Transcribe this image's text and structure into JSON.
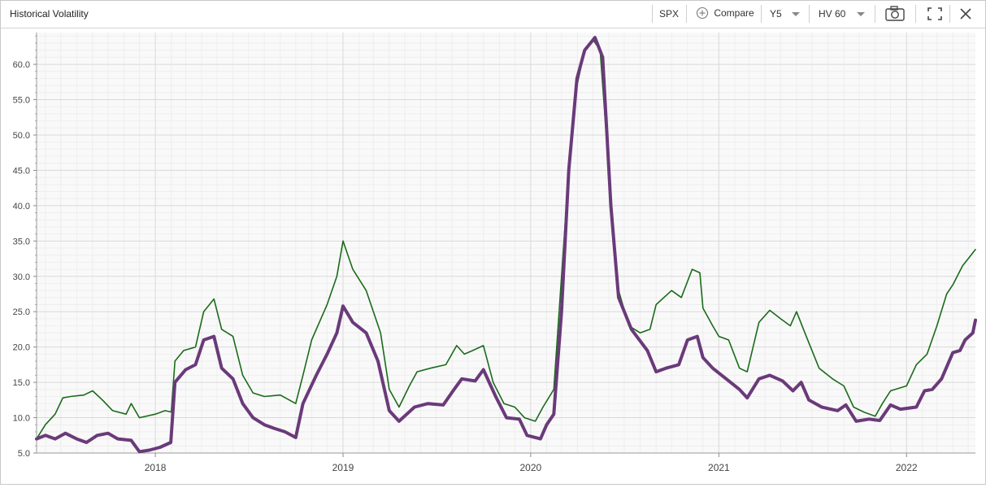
{
  "toolbar": {
    "title": "Historical Volatility",
    "symbol": "SPX",
    "compare_label": "Compare",
    "period": "Y5",
    "measure": "HV 60"
  },
  "colors": {
    "series_green": "#1a6b1a",
    "series_purple": "#6a3a7a",
    "grid_major": "#d9d9d9",
    "grid_minor": "#eeeeee",
    "plot_bg": "#f9f9f9"
  },
  "chart_data": {
    "type": "line",
    "x_axis": {
      "type": "date",
      "min": "2017-05-15",
      "max": "2022-05-15",
      "ticks": [
        "2018",
        "2019",
        "2020",
        "2021",
        "2022"
      ]
    },
    "y_axis": {
      "min": 5,
      "max": 64.5,
      "ticks": [
        "5.0",
        "10.0",
        "15.0",
        "20.0",
        "25.0",
        "30.0",
        "35.0",
        "40.0",
        "45.0",
        "50.0",
        "55.0",
        "60.0"
      ]
    },
    "grid": true,
    "series": [
      {
        "color": "#1a6b1a",
        "points": [
          [
            "2017-05-15",
            7.0
          ],
          [
            "2017-06-01",
            9.0
          ],
          [
            "2017-06-20",
            10.5
          ],
          [
            "2017-07-05",
            12.8
          ],
          [
            "2017-07-20",
            13.0
          ],
          [
            "2017-08-15",
            13.2
          ],
          [
            "2017-09-01",
            13.8
          ],
          [
            "2017-09-20",
            12.5
          ],
          [
            "2017-10-10",
            11.0
          ],
          [
            "2017-11-05",
            10.5
          ],
          [
            "2017-11-15",
            12.0
          ],
          [
            "2017-12-01",
            10.0
          ],
          [
            "2018-01-01",
            10.5
          ],
          [
            "2018-01-20",
            11.0
          ],
          [
            "2018-02-01",
            10.8
          ],
          [
            "2018-02-08",
            18.0
          ],
          [
            "2018-02-25",
            19.5
          ],
          [
            "2018-03-20",
            20.0
          ],
          [
            "2018-04-05",
            25.0
          ],
          [
            "2018-04-25",
            26.8
          ],
          [
            "2018-05-10",
            22.5
          ],
          [
            "2018-06-01",
            21.5
          ],
          [
            "2018-06-20",
            16.0
          ],
          [
            "2018-07-10",
            13.5
          ],
          [
            "2018-08-01",
            13.0
          ],
          [
            "2018-09-01",
            13.2
          ],
          [
            "2018-10-01",
            12.0
          ],
          [
            "2018-10-15",
            16.0
          ],
          [
            "2018-11-01",
            21.0
          ],
          [
            "2018-12-01",
            26.0
          ],
          [
            "2018-12-20",
            30.0
          ],
          [
            "2019-01-01",
            35.0
          ],
          [
            "2019-01-20",
            31.0
          ],
          [
            "2019-02-15",
            28.0
          ],
          [
            "2019-03-15",
            22.0
          ],
          [
            "2019-04-01",
            14.0
          ],
          [
            "2019-04-20",
            11.5
          ],
          [
            "2019-05-10",
            14.5
          ],
          [
            "2019-05-25",
            16.5
          ],
          [
            "2019-06-20",
            17.0
          ],
          [
            "2019-07-20",
            17.5
          ],
          [
            "2019-08-10",
            20.2
          ],
          [
            "2019-08-25",
            19.0
          ],
          [
            "2019-09-10",
            19.5
          ],
          [
            "2019-10-01",
            20.2
          ],
          [
            "2019-10-20",
            15.0
          ],
          [
            "2019-11-10",
            12.0
          ],
          [
            "2019-12-01",
            11.5
          ],
          [
            "2019-12-20",
            10.0
          ],
          [
            "2020-01-10",
            9.5
          ],
          [
            "2020-01-25",
            11.5
          ],
          [
            "2020-02-15",
            14.0
          ],
          [
            "2020-03-01",
            30.0
          ],
          [
            "2020-03-15",
            45.0
          ],
          [
            "2020-03-31",
            57.0
          ],
          [
            "2020-04-15",
            62.0
          ],
          [
            "2020-05-01",
            63.5
          ],
          [
            "2020-05-15",
            62.0
          ],
          [
            "2020-06-01",
            45.0
          ],
          [
            "2020-06-20",
            28.0
          ],
          [
            "2020-07-10",
            23.0
          ],
          [
            "2020-08-01",
            22.0
          ],
          [
            "2020-08-20",
            22.5
          ],
          [
            "2020-09-01",
            26.0
          ],
          [
            "2020-10-01",
            28.0
          ],
          [
            "2020-10-20",
            27.0
          ],
          [
            "2020-11-10",
            31.0
          ],
          [
            "2020-11-25",
            30.5
          ],
          [
            "2020-12-01",
            25.5
          ],
          [
            "2020-12-20",
            23.0
          ],
          [
            "2021-01-01",
            21.5
          ],
          [
            "2021-01-20",
            21.0
          ],
          [
            "2021-02-10",
            17.0
          ],
          [
            "2021-02-25",
            16.5
          ],
          [
            "2021-03-20",
            23.5
          ],
          [
            "2021-04-10",
            25.2
          ],
          [
            "2021-05-01",
            24.0
          ],
          [
            "2021-05-20",
            23.0
          ],
          [
            "2021-06-01",
            25.0
          ],
          [
            "2021-06-20",
            21.5
          ],
          [
            "2021-07-15",
            17.0
          ],
          [
            "2021-08-10",
            15.5
          ],
          [
            "2021-09-01",
            14.5
          ],
          [
            "2021-09-20",
            11.5
          ],
          [
            "2021-10-10",
            10.8
          ],
          [
            "2021-11-01",
            10.2
          ],
          [
            "2021-11-15",
            12.0
          ],
          [
            "2021-12-01",
            13.8
          ],
          [
            "2022-01-01",
            14.5
          ],
          [
            "2022-01-20",
            17.5
          ],
          [
            "2022-02-10",
            19.0
          ],
          [
            "2022-03-01",
            23.0
          ],
          [
            "2022-03-20",
            27.5
          ],
          [
            "2022-04-01",
            28.8
          ],
          [
            "2022-04-20",
            31.5
          ],
          [
            "2022-05-01",
            32.5
          ],
          [
            "2022-05-15",
            33.8
          ]
        ]
      },
      {
        "color": "#6a3a7a",
        "points": [
          [
            "2017-05-15",
            7.0
          ],
          [
            "2017-06-01",
            7.5
          ],
          [
            "2017-06-20",
            7.0
          ],
          [
            "2017-07-10",
            7.8
          ],
          [
            "2017-08-01",
            7.0
          ],
          [
            "2017-08-20",
            6.5
          ],
          [
            "2017-09-10",
            7.5
          ],
          [
            "2017-10-01",
            7.8
          ],
          [
            "2017-10-20",
            7.0
          ],
          [
            "2017-11-15",
            6.8
          ],
          [
            "2017-12-01",
            5.2
          ],
          [
            "2017-12-20",
            5.4
          ],
          [
            "2018-01-10",
            5.8
          ],
          [
            "2018-01-31",
            6.5
          ],
          [
            "2018-02-08",
            15.0
          ],
          [
            "2018-03-01",
            16.8
          ],
          [
            "2018-03-20",
            17.5
          ],
          [
            "2018-04-05",
            21.0
          ],
          [
            "2018-04-25",
            21.5
          ],
          [
            "2018-05-10",
            17.0
          ],
          [
            "2018-06-01",
            15.5
          ],
          [
            "2018-06-20",
            12.0
          ],
          [
            "2018-07-10",
            10.0
          ],
          [
            "2018-08-01",
            9.0
          ],
          [
            "2018-08-20",
            8.5
          ],
          [
            "2018-09-10",
            8.0
          ],
          [
            "2018-10-01",
            7.2
          ],
          [
            "2018-10-15",
            12.0
          ],
          [
            "2018-11-10",
            16.0
          ],
          [
            "2018-12-01",
            19.0
          ],
          [
            "2018-12-20",
            22.0
          ],
          [
            "2019-01-01",
            25.8
          ],
          [
            "2019-01-20",
            23.5
          ],
          [
            "2019-02-15",
            22.0
          ],
          [
            "2019-03-10",
            18.0
          ],
          [
            "2019-04-01",
            11.0
          ],
          [
            "2019-04-20",
            9.5
          ],
          [
            "2019-05-20",
            11.5
          ],
          [
            "2019-06-15",
            12.0
          ],
          [
            "2019-07-15",
            11.8
          ],
          [
            "2019-08-05",
            14.0
          ],
          [
            "2019-08-20",
            15.5
          ],
          [
            "2019-09-15",
            15.2
          ],
          [
            "2019-10-01",
            16.8
          ],
          [
            "2019-10-25",
            13.0
          ],
          [
            "2019-11-15",
            10.0
          ],
          [
            "2019-12-10",
            9.8
          ],
          [
            "2019-12-25",
            7.5
          ],
          [
            "2020-01-20",
            7.0
          ],
          [
            "2020-02-01",
            9.0
          ],
          [
            "2020-02-15",
            10.5
          ],
          [
            "2020-03-01",
            25.0
          ],
          [
            "2020-03-15",
            45.0
          ],
          [
            "2020-03-31",
            58.0
          ],
          [
            "2020-04-15",
            62.0
          ],
          [
            "2020-05-05",
            63.8
          ],
          [
            "2020-05-20",
            61.0
          ],
          [
            "2020-06-05",
            40.0
          ],
          [
            "2020-06-20",
            27.0
          ],
          [
            "2020-07-15",
            22.5
          ],
          [
            "2020-08-15",
            19.5
          ],
          [
            "2020-09-01",
            16.5
          ],
          [
            "2020-09-20",
            17.0
          ],
          [
            "2020-10-15",
            17.5
          ],
          [
            "2020-11-01",
            21.0
          ],
          [
            "2020-11-20",
            21.5
          ],
          [
            "2020-12-01",
            18.5
          ],
          [
            "2020-12-20",
            17.0
          ],
          [
            "2021-01-10",
            15.8
          ],
          [
            "2021-02-10",
            14.0
          ],
          [
            "2021-02-25",
            12.8
          ],
          [
            "2021-03-20",
            15.5
          ],
          [
            "2021-04-10",
            16.0
          ],
          [
            "2021-05-05",
            15.2
          ],
          [
            "2021-05-25",
            13.8
          ],
          [
            "2021-06-10",
            15.0
          ],
          [
            "2021-06-25",
            12.5
          ],
          [
            "2021-07-20",
            11.5
          ],
          [
            "2021-08-20",
            11.0
          ],
          [
            "2021-09-05",
            11.8
          ],
          [
            "2021-09-25",
            9.5
          ],
          [
            "2021-10-20",
            9.8
          ],
          [
            "2021-11-10",
            9.6
          ],
          [
            "2021-12-01",
            11.8
          ],
          [
            "2021-12-20",
            11.2
          ],
          [
            "2022-01-20",
            11.5
          ],
          [
            "2022-02-05",
            13.8
          ],
          [
            "2022-02-20",
            14.0
          ],
          [
            "2022-03-10",
            15.5
          ],
          [
            "2022-04-01",
            19.2
          ],
          [
            "2022-04-15",
            19.5
          ],
          [
            "2022-04-25",
            21.0
          ],
          [
            "2022-05-10",
            22.0
          ],
          [
            "2022-05-15",
            23.8
          ]
        ]
      }
    ]
  }
}
